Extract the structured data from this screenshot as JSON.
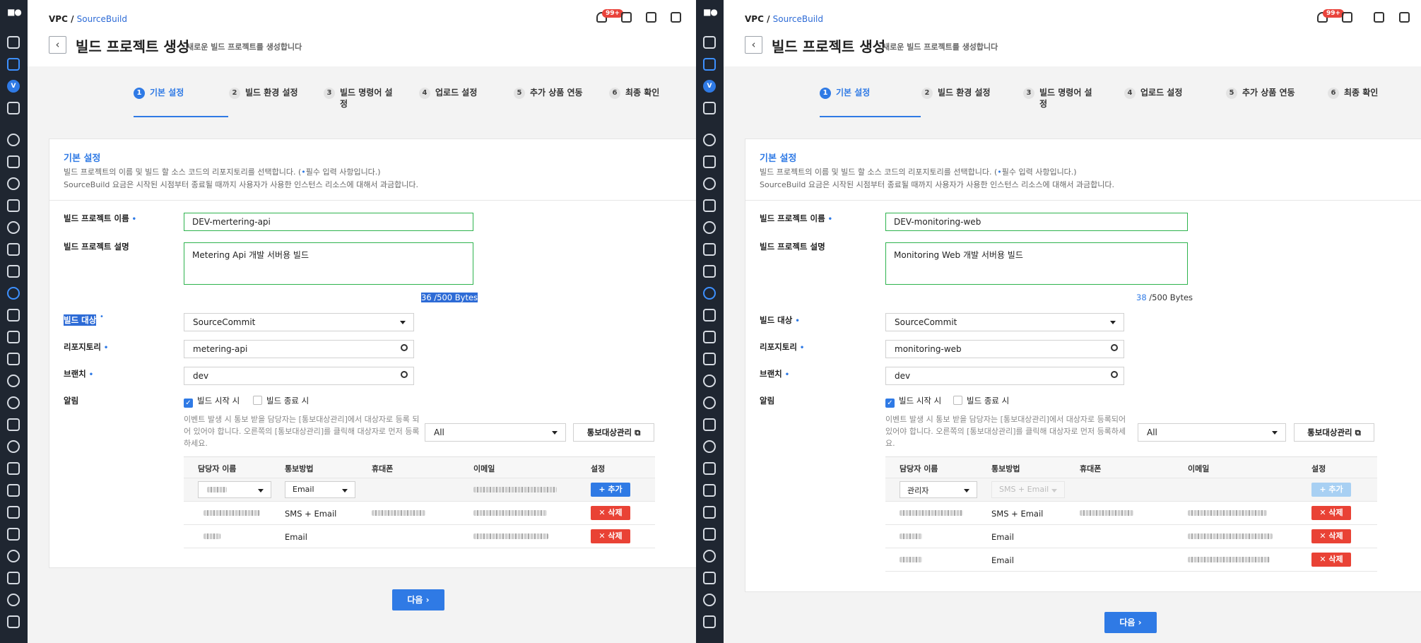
{
  "common": {
    "logo": "■●",
    "breadcrumb_root": "VPC",
    "breadcrumb_sep": "/",
    "breadcrumb_link": "SourceBuild",
    "back_glyph": "‹",
    "page_title": "빌드 프로젝트 생성",
    "page_subtitle": "새로운 빌드 프로젝트를 생성합니다",
    "notif_badge": "99+",
    "v_badge": "V",
    "steps": [
      {
        "num": "1",
        "label": "기본 설정"
      },
      {
        "num": "2",
        "label": "빌드 환경 설정"
      },
      {
        "num": "3",
        "label": "빌드 명령어 설"
      },
      {
        "num": "4",
        "label": "업로드 설정"
      },
      {
        "num": "5",
        "label": "추가 상품 연동"
      },
      {
        "num": "6",
        "label": "최종 확인"
      }
    ],
    "step3_line2": "정",
    "section_title": "기본 설정",
    "desc1_pre": "빌드 프로젝트의 이름 및 빌드 할 소스 코드의 리포지토리를 선택합니다. (",
    "desc1_dot": "•",
    "desc1_post": "필수 입력 사항입니다.)",
    "desc2": "SourceBuild 요금은 시작된 시점부터 종료될 때까지 사용자가 사용한 인스턴스 리소스에 대해서 과금합니다.",
    "label_name": "빌드 프로젝트 이름",
    "label_desc": "빌드 프로젝트 설명",
    "label_target": "빌드 대상",
    "label_repo": "리포지토리",
    "label_branch": "브랜치",
    "label_notify": "알림",
    "req_mark": "•",
    "count_suffix": " /500 Bytes",
    "chk_start": "빌드 시작 시",
    "chk_end": "빌드 종료 시",
    "chk_mark": "✓",
    "notify_note_left": "이벤트 발생 시 통보 받을 담당자는 [통보대상관리]에서 대상자로 등록 되어 있어야 합니다. 오른쪽의 [통보대상관리]를 클릭해 대상자로 먼저 등록하세요.",
    "notify_note_right": "이벤트 발생 시 통보 받을 담당자는 [통보대상관리]에서 대상자로 등록되어 있어야 합니다. 오른쪽의 [통보대상관리]를 클릭해 대상자로 먼저 등록하세요.",
    "filter_all": "All",
    "manage_btn": "통보대상관리 ⧉",
    "table_headers": [
      "담당자 이름",
      "통보방법",
      "휴대폰",
      "이메일",
      "설정"
    ],
    "add_btn": "+ 추가",
    "del_btn": "✕ 삭제",
    "method_email": "Email",
    "method_sms_email": "SMS + Email",
    "next_btn": "다음 ›"
  },
  "left": {
    "project_name": "DEV-mertering-api",
    "project_desc": "Metering Api 개발 서버용 빌드",
    "desc_count": "36",
    "build_target": "SourceCommit",
    "repository": "metering-api",
    "branch": "dev",
    "notify_start_checked": true,
    "new_row_method": "Email",
    "rows": [
      {
        "method": "SMS + Email"
      },
      {
        "method": "Email"
      }
    ]
  },
  "right": {
    "project_name": "DEV-monitoring-web",
    "project_desc": "Monitoring Web 개발 서버용 빌드",
    "desc_count": "38",
    "build_target": "SourceCommit",
    "repository": "monitoring-web",
    "branch": "dev",
    "notify_start_checked": true,
    "new_row_name": "관리자",
    "new_row_method": "SMS + Email",
    "rows": [
      {
        "method": "SMS + Email"
      },
      {
        "method": "Email"
      },
      {
        "method": "Email"
      }
    ]
  }
}
